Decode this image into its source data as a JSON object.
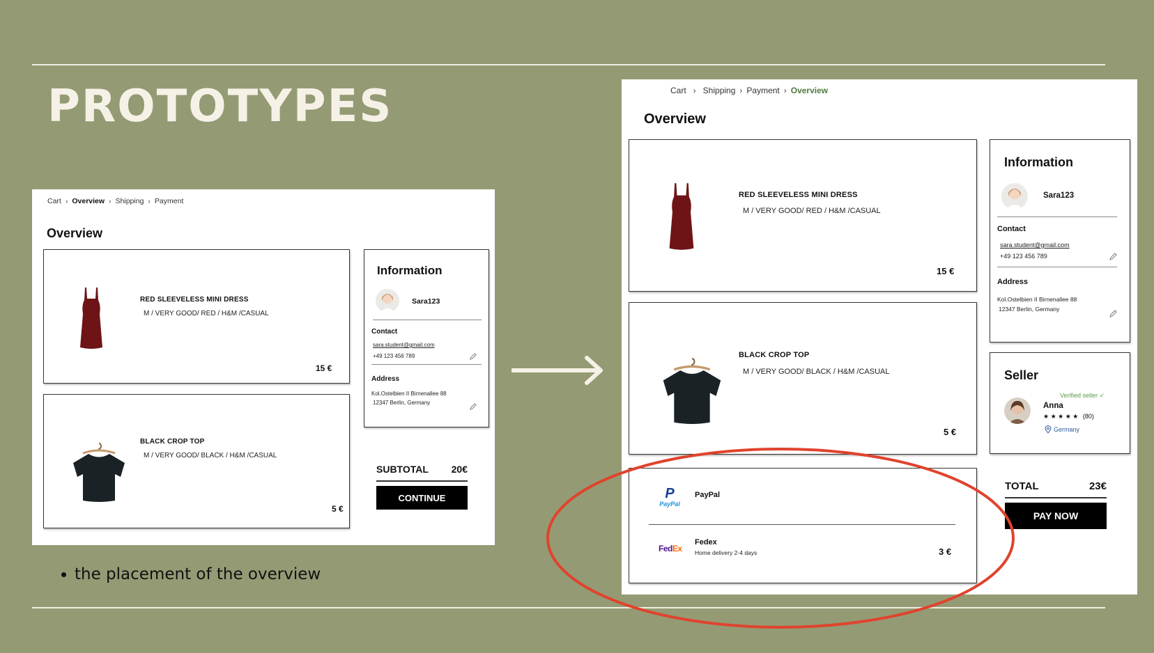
{
  "slide": {
    "title": "PROTOTYPES",
    "bullet": "the placement of the overview"
  },
  "old_prototype": {
    "breadcrumb": [
      "Cart",
      "Overview",
      "Shipping",
      "Payment"
    ],
    "current_step": "Overview",
    "page_title": "Overview",
    "products": [
      {
        "name": "RED SLEEVELESS MINI DRESS",
        "meta": "M / VERY GOOD/ RED  / H&M /CASUAL",
        "price": "15 €",
        "image": "red-dress"
      },
      {
        "name": "BLACK CROP TOP",
        "meta": "M / VERY GOOD/ BLACK  / H&M /CASUAL",
        "price": "5 €",
        "image": "black-top"
      }
    ],
    "information": {
      "heading": "Information",
      "username": "Sara123",
      "contact_label": "Contact",
      "email": "sara.student@gmail.com",
      "phone": "+49 123 456 789",
      "address_label": "Address",
      "address_line1": "Kol.Ostelbien II Birnenallee 88",
      "address_line2": "12347 Berlin, Germany"
    },
    "subtotal_label": "SUBTOTAL",
    "subtotal_value": "20€",
    "continue_label": "CONTINUE"
  },
  "new_prototype": {
    "breadcrumb": [
      "Cart",
      "Shipping",
      "Payment",
      "Overview"
    ],
    "current_step": "Overview",
    "page_title": "Overview",
    "products": [
      {
        "name": "RED SLEEVELESS MINI DRESS",
        "meta": "M / VERY GOOD/ RED  / H&M /CASUAL",
        "price": "15 €",
        "image": "red-dress"
      },
      {
        "name": "BLACK CROP TOP",
        "meta": "M / VERY GOOD/  BLACK  / H&M /CASUAL",
        "price": "5 €",
        "image": "black-top"
      }
    ],
    "payment": {
      "name": "PayPal",
      "logo_top": "P",
      "logo_text": "PayPal"
    },
    "shipping": {
      "name": "Fedex",
      "detail": "Home delivery 2-4 days",
      "price": "3 €",
      "logo_fed": "Fed",
      "logo_ex": "Ex"
    },
    "information": {
      "heading": "Information",
      "username": "Sara123",
      "contact_label": "Contact",
      "email": "sara.student@gmail.com",
      "phone": "+49 123 456 789",
      "address_label": "Address",
      "address_line1": "Kol.Ostelbien II Birnenallee 88",
      "address_line2": "12347 Berlin, Germany"
    },
    "seller": {
      "heading": "Seller",
      "verified": "Verified seller ✓",
      "name": "Anna",
      "stars": "★ ★ ★ ★ ★",
      "reviews": "(80)",
      "location": "Germany"
    },
    "total_label": "TOTAL",
    "total_value": "23€",
    "pay_label": "PAY NOW"
  },
  "colors": {
    "background": "#949b74",
    "title": "#f6f1e6",
    "highlight_ellipse": "#e0432d",
    "breadcrumb_active_new": "#4e7a3f",
    "verified_green": "#5a9a4a"
  },
  "icons": [
    "arrow-right-icon",
    "pencil-icon",
    "location-pin-icon",
    "chevron-right-icon"
  ]
}
